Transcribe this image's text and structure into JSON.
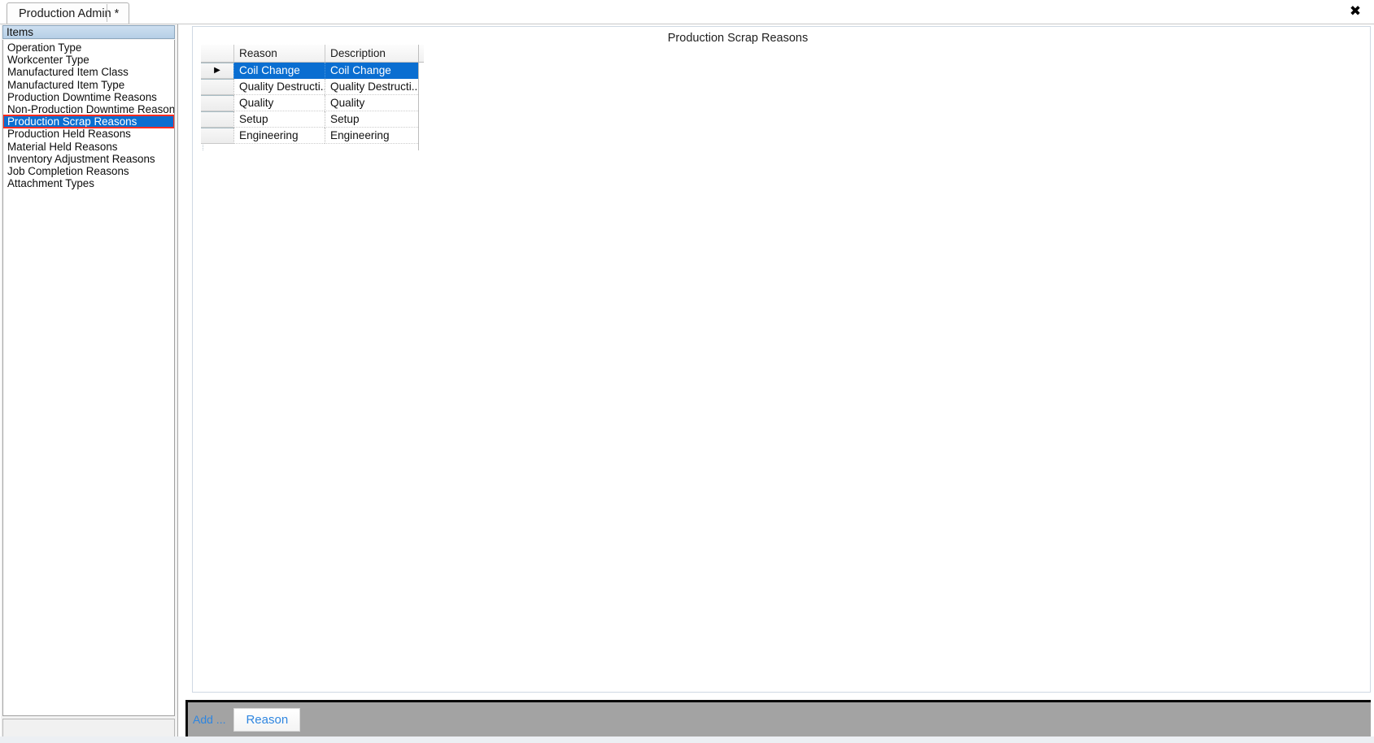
{
  "window": {
    "close_icon": "close-icon",
    "close_glyph": "✖"
  },
  "tabs": [
    {
      "label": "Production Admin *"
    }
  ],
  "sidebar": {
    "header": "Items",
    "items": [
      {
        "label": "Operation Type",
        "selected": false
      },
      {
        "label": "Workcenter Type",
        "selected": false
      },
      {
        "label": "Manufactured Item Class",
        "selected": false
      },
      {
        "label": "Manufactured Item Type",
        "selected": false
      },
      {
        "label": "Production Downtime Reasons",
        "selected": false
      },
      {
        "label": "Non-Production Downtime Reasons",
        "selected": false
      },
      {
        "label": "Production Scrap Reasons",
        "selected": true
      },
      {
        "label": "Production Held Reasons",
        "selected": false
      },
      {
        "label": "Material Held Reasons",
        "selected": false
      },
      {
        "label": "Inventory Adjustment Reasons",
        "selected": false
      },
      {
        "label": "Job Completion Reasons",
        "selected": false
      },
      {
        "label": "Attachment Types",
        "selected": false
      }
    ]
  },
  "main": {
    "title": "Production Scrap Reasons",
    "grid": {
      "columns": [
        "Reason",
        "Description"
      ],
      "row_marker_glyph": "▶",
      "rows": [
        {
          "reason": "Coil Change",
          "description": "Coil Change",
          "selected": true
        },
        {
          "reason": "Quality Destructi...",
          "description": "Quality Destructi...",
          "selected": false
        },
        {
          "reason": "Quality",
          "description": "Quality",
          "selected": false
        },
        {
          "reason": "Setup",
          "description": "Setup",
          "selected": false
        },
        {
          "reason": "Engineering",
          "description": "Engineering",
          "selected": false
        }
      ]
    }
  },
  "toolbar": {
    "add_label": "Add ...",
    "reason_button": "Reason"
  },
  "colors": {
    "selection_blue": "#0a6ed1",
    "highlight_red": "#ff2b20",
    "toolbar_gray": "#a3a3a3",
    "link_blue": "#2f86e0"
  }
}
